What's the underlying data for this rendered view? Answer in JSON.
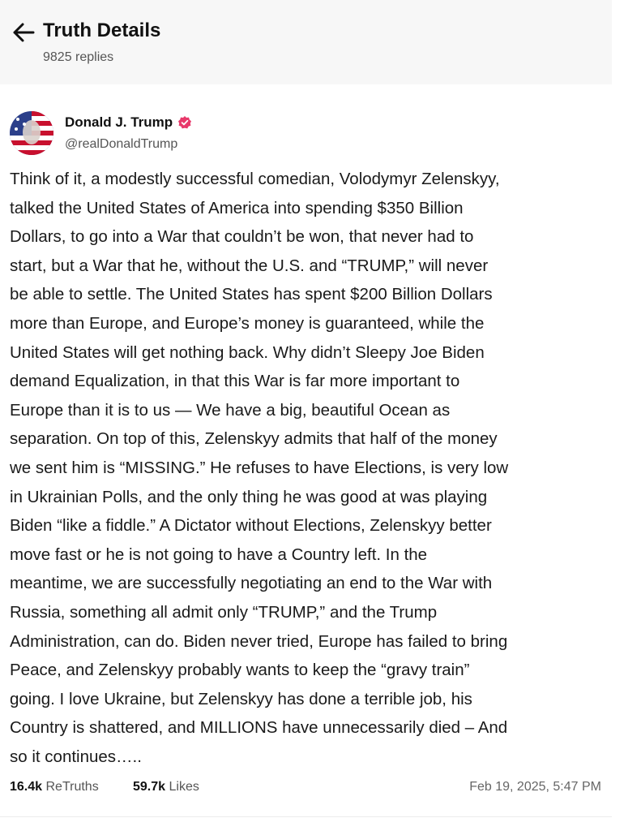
{
  "header": {
    "title": "Truth Details",
    "replies": "9825 replies"
  },
  "post": {
    "author_name": "Donald J. Trump",
    "author_handle": "@realDonaldTrump",
    "body_lines": [
      "Think of it, a modestly successful comedian, Volodymyr Zelenskyy,",
      "talked the United States of America into spending $350 Billion",
      "Dollars, to go into a War that couldn’t be won, that never had to",
      "start, but a War that he, without the U.S. and “TRUMP,” will never",
      "be able to settle. The United States has spent $200 Billion Dollars",
      "more than Europe, and Europe’s money is guaranteed, while the",
      "United States will get nothing back. Why didn’t Sleepy Joe Biden",
      "demand Equalization, in that this War is far more important to",
      "Europe than it is to us — We have a big, beautiful Ocean as",
      "separation. On top of this, Zelenskyy admits that half of the money",
      "we sent him is “MISSING.” He refuses to have Elections, is very low",
      "in Ukrainian Polls, and the only thing he was good at was playing",
      "Biden “like a fiddle.” A Dictator without Elections, Zelenskyy better",
      "move fast or he is not going to have a Country left. In the",
      "meantime, we are successfully negotiating an end to the War with",
      "Russia, something all admit only “TRUMP,” and the Trump",
      "Administration, can do. Biden never tried, Europe has failed to bring",
      "Peace, and Zelenskyy probably wants to keep the “gravy train”",
      "going. I love Ukraine, but Zelenskyy has done a terrible job, his",
      "Country is shattered, and MILLIONS have unnecessarily died – And",
      "so it continues….."
    ],
    "retruths_count": "16.4k",
    "retruths_label": "ReTruths",
    "likes_count": "59.7k",
    "likes_label": "Likes",
    "timestamp": "Feb 19, 2025, 5:47 PM"
  },
  "icons": {
    "back": "arrow-left-icon",
    "verified": "verified-badge-icon",
    "avatar": "profile-avatar"
  },
  "colors": {
    "verified_badge": "#e8396b",
    "header_bg": "#f7f7f7"
  }
}
